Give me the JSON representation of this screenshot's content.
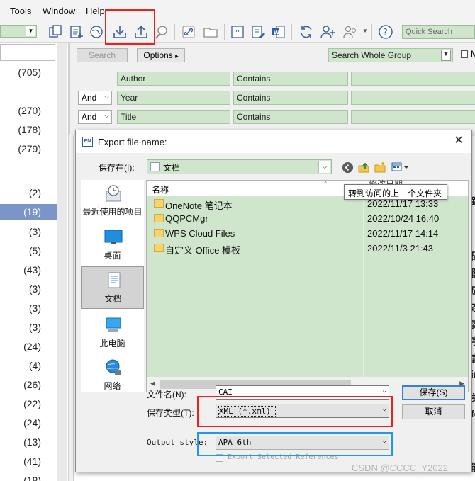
{
  "menubar": {
    "items": [
      "Tools",
      "Window",
      "Help"
    ]
  },
  "toolbar": {
    "quick_search_placeholder": "Quick Search",
    "icons": [
      "copy-icon",
      "new-reference-icon",
      "globe-icon",
      "import-icon",
      "export-icon",
      "find-fulltext-icon",
      "link-icon",
      "folder-icon",
      "quote-icon",
      "edit-icon",
      "word-icon",
      "sync-icon",
      "add-user-icon",
      "share-icon",
      "help-icon"
    ]
  },
  "left_pane": {
    "counts": [
      "(705)",
      "(270)",
      "(178)",
      "(279)",
      "(2)",
      "(19)",
      "(3)",
      "(5)",
      "(43)",
      "(3)",
      "(3)",
      "(3)",
      "(24)",
      "(4)",
      "(26)",
      "(22)",
      "(24)",
      "(13)",
      "(41)",
      "(18)"
    ],
    "selected_count": "(19)"
  },
  "search_panel": {
    "search_button": "Search",
    "options_button": "Options",
    "options_arrow": "▸",
    "scope": "Search Whole Group",
    "match_label": "M",
    "rows": [
      {
        "bool": "",
        "field": "Author",
        "operator": "Contains"
      },
      {
        "bool": "And",
        "field": "Year",
        "operator": "Contains"
      },
      {
        "bool": "And",
        "field": "Title",
        "operator": "Contains"
      }
    ]
  },
  "bg_doc_chars": [
    "致",
    "础",
    "衡",
    "应",
    "态",
    "实",
    "字",
    "言",
    "in",
    "关",
    "fo",
    "能"
  ],
  "dialog": {
    "app_icon": "EN",
    "title": "Export file name:",
    "close": "✕",
    "save_in_label": "保存在(I):",
    "save_in_value": "文档",
    "tooltip": "转到访问的上一个文件夹",
    "places": [
      "最近使用的项目",
      "桌面",
      "文档",
      "此电脑",
      "网络"
    ],
    "selected_place": "文档",
    "columns": {
      "name": "名称",
      "date": "修改日期"
    },
    "files": [
      {
        "name": "OneNote 笔记本",
        "date": "2022/11/17 13:33"
      },
      {
        "name": "QQPCMgr",
        "date": "2022/10/24 16:40"
      },
      {
        "name": "WPS Cloud Files",
        "date": "2022/11/17 14:14"
      },
      {
        "name": "自定义 Office 模板",
        "date": "2022/11/3 21:43"
      }
    ],
    "filename_label": "文件名(N):",
    "filename_value": "CAI",
    "savetype_label": "保存类型(T):",
    "savetype_value": "XML (*.xml)",
    "output_style_label": "Output style:",
    "output_style_value": "APA 6th",
    "export_selected_label": "Export Selected References",
    "save_button": "保存(S)",
    "cancel_button": "取消"
  },
  "watermark": "CSDN @CCCC_Y2022",
  "colors": {
    "annotation_red": "#e8231f",
    "annotation_blue": "#2196f3",
    "field_green": "#cfe6cd",
    "selected_row": "#7b95c8"
  }
}
